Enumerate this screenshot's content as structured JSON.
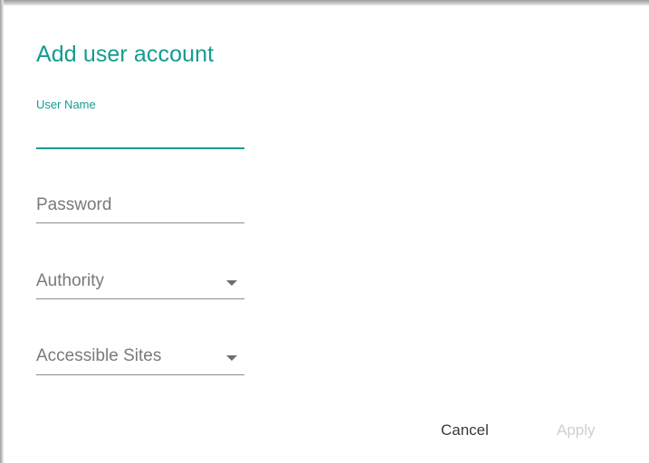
{
  "dialog": {
    "title": "Add user account"
  },
  "fields": {
    "user_name": {
      "label": "User Name",
      "value": ""
    },
    "password": {
      "placeholder": "Password",
      "value": ""
    },
    "authority": {
      "placeholder": "Authority",
      "icon": "dropdown-arrow-icon"
    },
    "accessible_sites": {
      "placeholder": "Accessible Sites",
      "icon": "dropdown-arrow-icon"
    }
  },
  "actions": {
    "cancel_label": "Cancel",
    "apply_label": "Apply",
    "apply_enabled": false
  },
  "colors": {
    "accent": "#129c8f",
    "underline": "#8c8c8c",
    "placeholder": "#7a7a7a",
    "disabled": "#cfcfcf"
  }
}
